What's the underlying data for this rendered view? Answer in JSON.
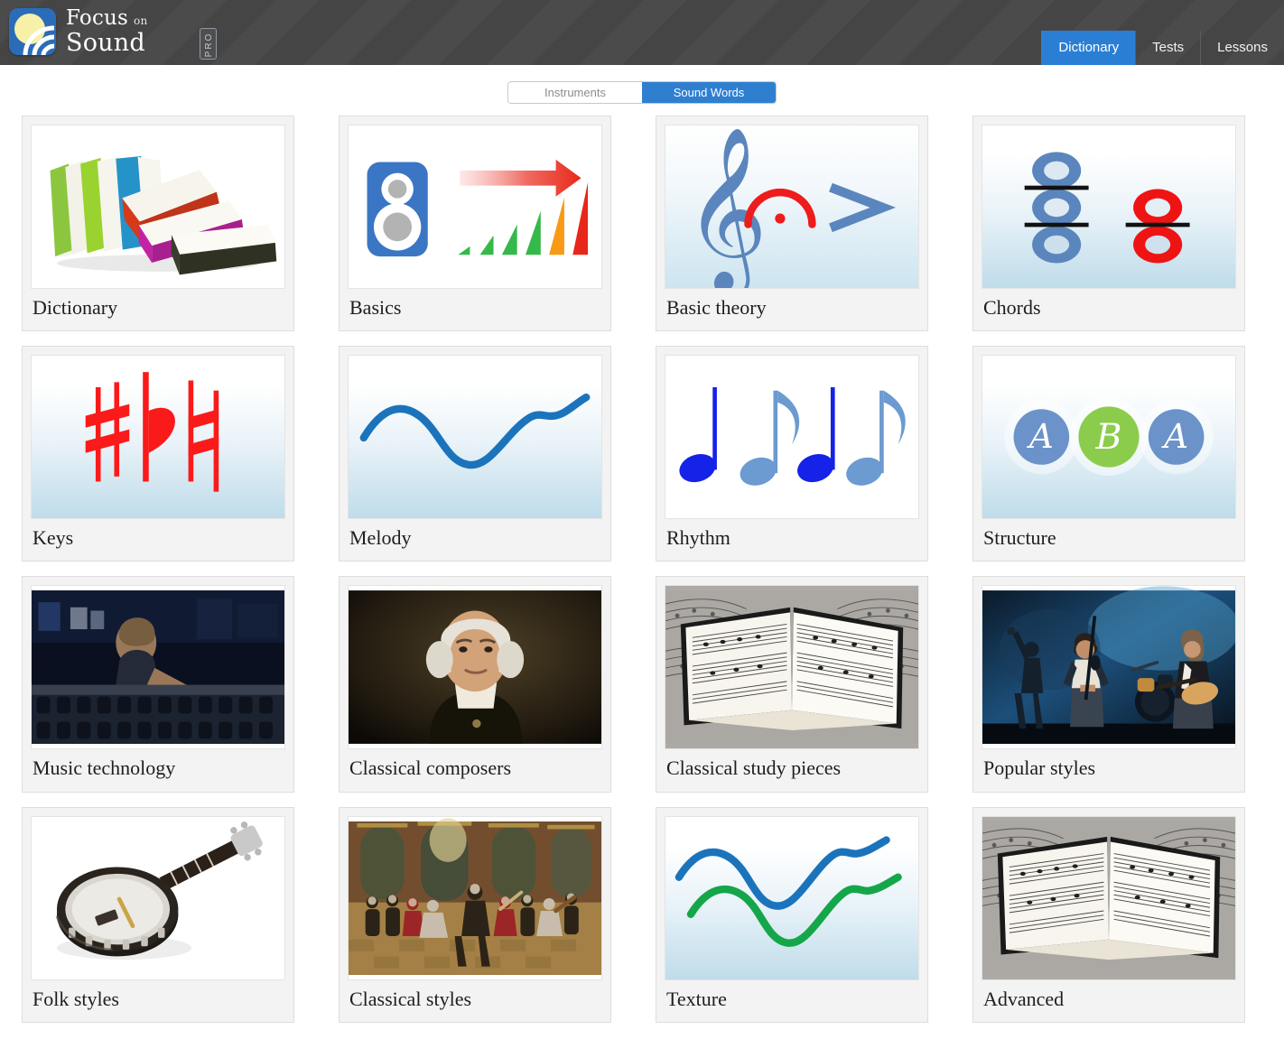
{
  "header": {
    "brand": {
      "line1": "Focus",
      "on": "on",
      "line2": "Sound",
      "badge": "PRO",
      "logo_icon": "sun-soundwave-icon",
      "bg_color": "#474747"
    },
    "nav": {
      "accent_color": "#2a7fd4",
      "tabs": [
        {
          "label": "Dictionary",
          "active": true
        },
        {
          "label": "Tests",
          "active": false
        },
        {
          "label": "Lessons",
          "active": false
        }
      ]
    }
  },
  "toggle": {
    "active_color": "#2f7fd1",
    "options": [
      {
        "label": "Instruments",
        "active": false
      },
      {
        "label": "Sound Words",
        "active": true
      }
    ]
  },
  "grid": {
    "cards": [
      {
        "label": "Dictionary",
        "art": "books-photo"
      },
      {
        "label": "Basics",
        "art": "speaker-volume-icon"
      },
      {
        "label": "Basic theory",
        "art": "treble-clef-fermata-accent-icon"
      },
      {
        "label": "Chords",
        "art": "stacked-noteheads-icon"
      },
      {
        "label": "Keys",
        "art": "accidentals-icon"
      },
      {
        "label": "Melody",
        "art": "melody-contour-icon"
      },
      {
        "label": "Rhythm",
        "art": "quarter-eighth-notes-icon"
      },
      {
        "label": "Structure",
        "art": "aba-circles-icon"
      },
      {
        "label": "Music technology",
        "art": "mixing-desk-photo"
      },
      {
        "label": "Classical composers",
        "art": "bach-portrait-photo"
      },
      {
        "label": "Classical study pieces",
        "art": "open-score-book-photo"
      },
      {
        "label": "Popular styles",
        "art": "rock-band-stage-photo"
      },
      {
        "label": "Folk styles",
        "art": "banjo-photo"
      },
      {
        "label": "Classical styles",
        "art": "baroque-concert-painting"
      },
      {
        "label": "Texture",
        "art": "two-contour-lines-icon"
      },
      {
        "label": "Advanced",
        "art": "open-score-book-photo"
      }
    ]
  }
}
